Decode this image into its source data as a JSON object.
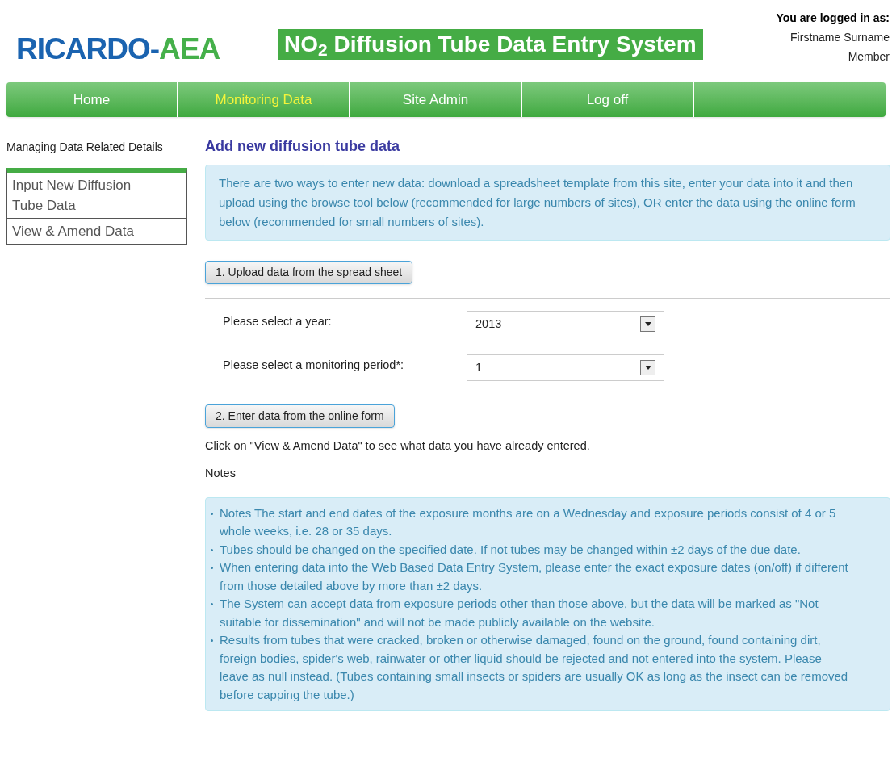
{
  "header": {
    "logo": {
      "primary": "RICARDO-",
      "secondary": "AEA"
    },
    "title": "NO$_{2}$ Diffusion Tube Data Entry System",
    "login": {
      "label": "You are logged in as:",
      "name": "Firstname Surname",
      "role": "Member"
    }
  },
  "nav": [
    {
      "label": "Home",
      "selected": false
    },
    {
      "label": "Monitoring Data",
      "selected": true
    },
    {
      "label": "Site Admin",
      "selected": false
    },
    {
      "label": "Log off",
      "selected": false
    }
  ],
  "sidebar": {
    "heading": "Managing Data Related Details",
    "items": [
      {
        "label": "Input New Diffusion Tube Data"
      },
      {
        "label": "View & Amend Data"
      }
    ]
  },
  "main": {
    "heading": "Add new diffusion tube data",
    "intro": "There are two ways to enter new data: download a spreadsheet template from this site, enter your data into it and then upload using the browse tool below (recommended for large numbers of sites), OR enter the data using the online form below (recommended for small numbers of sites).",
    "upload_button": "1. Upload data from the spread sheet",
    "fields": [
      {
        "label": "Please select a year:",
        "value": "2013"
      },
      {
        "label": "Please select a monitoring period*:",
        "value": "1"
      }
    ],
    "enter_button": "2. Enter data from the online form",
    "hint": "Click on \"View & Amend Data\" to see what data you have already entered.",
    "notes_heading": "Notes",
    "notes": [
      "Notes The start and end dates of the exposure months are on a Wednesday and exposure periods consist of 4 or 5 whole weeks, i.e. 28 or 35 days.",
      "Tubes should be changed on the specified date. If not tubes may be changed within ±2 days of the due date.",
      "When entering data into the Web Based Data Entry System, please enter the exact exposure dates (on/off) if different from those detailed above by more than ±2 days.",
      "The System can accept data from exposure periods other than those above, but the data will be marked as \"Not suitable for dissemination\" and will not be made publicly available on the website.",
      "Results from tubes that were cracked, broken or otherwise damaged, found on the ground, found containing dirt, foreign bodies, spider's web, rainwater or other liquid should be rejected and not entered into the system. Please leave as null instead. (Tubes containing small insects or spiders are usually OK as long as the insect can be removed before capping the tube.)"
    ]
  }
}
